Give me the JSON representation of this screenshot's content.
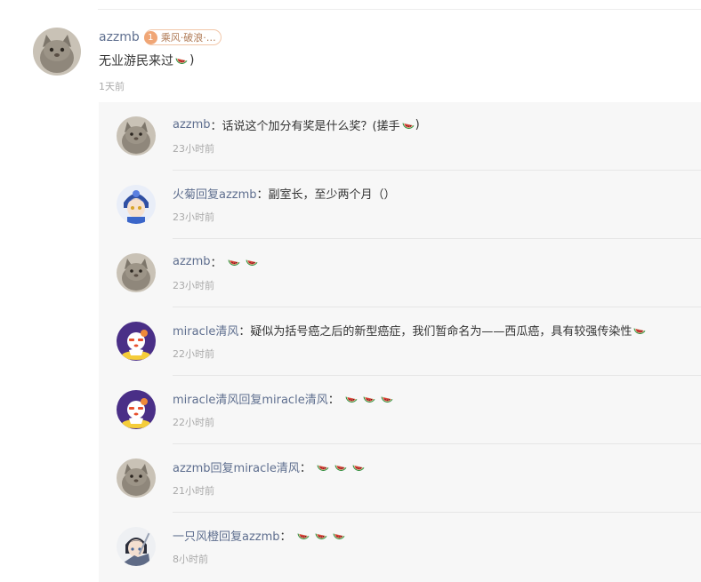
{
  "comment": {
    "username": "azzmb",
    "badge_level": "1",
    "badge_text": "乘风·破浪·…",
    "text": "无业游民来过",
    "text_suffix": ")",
    "time": "1天前"
  },
  "replies": [
    {
      "author": "azzmb",
      "separator": "：",
      "text": "话说这个加分有奖是什么奖？(搓手",
      "text_suffix": ")",
      "emoji_count": 1,
      "time": "23小时前",
      "avatar": "cat-avatar"
    },
    {
      "author": "火菊回复azzmb",
      "separator": "：",
      "text": "副室长，至少两个月（）",
      "text_suffix": "",
      "emoji_count": 0,
      "time": "23小时前",
      "avatar": "anime-boy-avatar"
    },
    {
      "author": "azzmb",
      "separator": "：",
      "text": "",
      "text_suffix": "",
      "emoji_count": 2,
      "time": "23小时前",
      "avatar": "cat-avatar"
    },
    {
      "author": "miracle清风",
      "separator": "：",
      "text": "疑似为括号癌之后的新型癌症，我们暂命名为——西瓜癌，具有较强传染性",
      "text_suffix": "",
      "emoji_count": 1,
      "time": "22小时前",
      "avatar": "cartoon-avatar"
    },
    {
      "author": "miracle清风回复miracle清风",
      "separator": "：",
      "text": "",
      "text_suffix": "",
      "emoji_count": 3,
      "time": "22小时前",
      "avatar": "cartoon-avatar"
    },
    {
      "author": "azzmb回复miracle清风",
      "separator": "：",
      "text": "",
      "text_suffix": "",
      "emoji_count": 3,
      "time": "21小时前",
      "avatar": "cat-avatar"
    },
    {
      "author": "一只风橙回复azzmb",
      "separator": "：",
      "text": "",
      "text_suffix": "",
      "emoji_count": 3,
      "time": "8小时前",
      "avatar": "anime-swordsman-avatar"
    }
  ],
  "emoji_name": "watermelon-emoji"
}
